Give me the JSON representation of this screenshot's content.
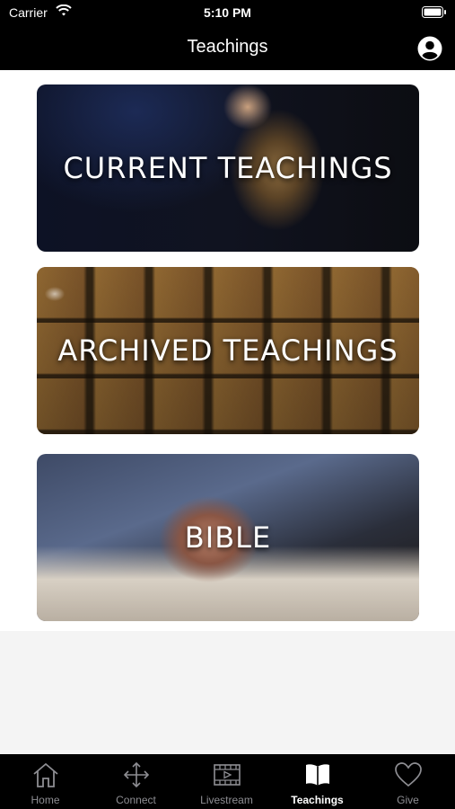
{
  "status_bar": {
    "carrier": "Carrier",
    "time": "5:10 PM"
  },
  "header": {
    "title": "Teachings"
  },
  "cards": [
    {
      "label": "CURRENT TEACHINGS"
    },
    {
      "label": "ARCHIVED TEACHINGS"
    },
    {
      "label": "BIBLE"
    }
  ],
  "tabs": [
    {
      "label": "Home",
      "icon": "home-icon"
    },
    {
      "label": "Connect",
      "icon": "move-arrows-icon"
    },
    {
      "label": "Livestream",
      "icon": "video-icon"
    },
    {
      "label": "Teachings",
      "icon": "book-icon",
      "active": true
    },
    {
      "label": "Give",
      "icon": "heart-icon"
    }
  ],
  "colors": {
    "bar_background": "#000000",
    "active_tab": "#ffffff",
    "inactive_tab": "#8e8e93"
  }
}
